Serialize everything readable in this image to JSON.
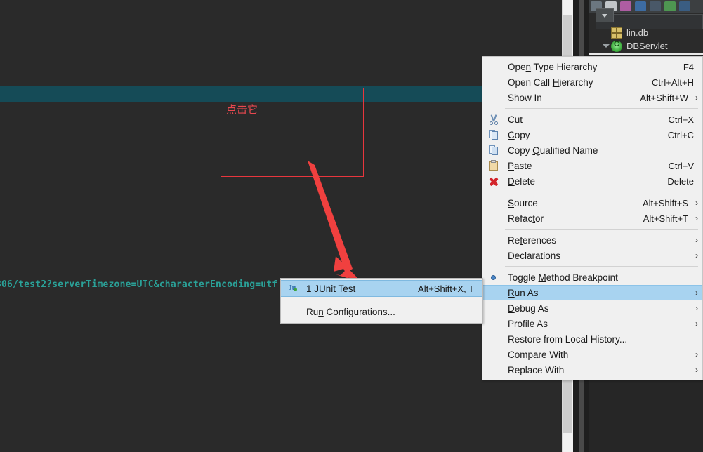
{
  "editor": {
    "code_line": "306/test2?serverTimezone=UTC&characterEncoding=utf",
    "code_color": "#2aa198",
    "background": "#2a2a2a",
    "selected_line_color": "#154b57"
  },
  "annotation": {
    "text": "点击它",
    "color": "#e8484f",
    "box_border_color": "#e8363d",
    "arrow_color": "#f0403f"
  },
  "package_explorer": {
    "tree": [
      {
        "label": "lin.db",
        "icon": "database-icon",
        "expandable": false
      },
      {
        "label": "DBServlet",
        "icon": "java-class-icon",
        "expandable": true
      }
    ]
  },
  "context_menu": {
    "items": [
      {
        "label": "Open Type Hierarchy",
        "accel": "F4",
        "icon": "",
        "submenu": false,
        "selected": false,
        "mnemonic": 3
      },
      {
        "label": "Open Call Hierarchy",
        "accel": "Ctrl+Alt+H",
        "icon": "",
        "submenu": false,
        "selected": false,
        "mnemonic": 10
      },
      {
        "label": "Show In",
        "accel": "Alt+Shift+W",
        "icon": "",
        "submenu": true,
        "selected": false,
        "mnemonic": 3
      },
      {
        "separator": true
      },
      {
        "label": "Cut",
        "accel": "Ctrl+X",
        "icon": "cut-icon",
        "submenu": false,
        "selected": false,
        "mnemonic": 2
      },
      {
        "label": "Copy",
        "accel": "Ctrl+C",
        "icon": "copy-icon",
        "submenu": false,
        "selected": false,
        "mnemonic": 0
      },
      {
        "label": "Copy Qualified Name",
        "accel": "",
        "icon": "copy-qualified-icon",
        "submenu": false,
        "selected": false,
        "mnemonic": 6
      },
      {
        "label": "Paste",
        "accel": "Ctrl+V",
        "icon": "paste-icon",
        "submenu": false,
        "selected": false,
        "mnemonic": 0
      },
      {
        "label": "Delete",
        "accel": "Delete",
        "icon": "delete-icon",
        "submenu": false,
        "selected": false,
        "mnemonic": 0
      },
      {
        "separator": true
      },
      {
        "label": "Source",
        "accel": "Alt+Shift+S",
        "icon": "",
        "submenu": true,
        "selected": false,
        "mnemonic": 0
      },
      {
        "label": "Refactor",
        "accel": "Alt+Shift+T",
        "icon": "",
        "submenu": true,
        "selected": false,
        "mnemonic": 6
      },
      {
        "separator": true
      },
      {
        "label": "References",
        "accel": "",
        "icon": "",
        "submenu": true,
        "selected": false,
        "mnemonic": 2
      },
      {
        "label": "Declarations",
        "accel": "",
        "icon": "",
        "submenu": true,
        "selected": false,
        "mnemonic": 2
      },
      {
        "separator": true
      },
      {
        "label": "Toggle Method Breakpoint",
        "accel": "",
        "icon": "breakpoint-icon",
        "submenu": false,
        "selected": false,
        "mnemonic": 7
      },
      {
        "label": "Run As",
        "accel": "",
        "icon": "",
        "submenu": true,
        "selected": true,
        "mnemonic": 0
      },
      {
        "label": "Debug As",
        "accel": "",
        "icon": "",
        "submenu": true,
        "selected": false,
        "mnemonic": 0
      },
      {
        "label": "Profile As",
        "accel": "",
        "icon": "",
        "submenu": true,
        "selected": false,
        "mnemonic": 0
      },
      {
        "label": "Restore from Local History...",
        "accel": "",
        "icon": "",
        "submenu": false,
        "selected": false,
        "mnemonic": 20
      },
      {
        "label": "Compare With",
        "accel": "",
        "icon": "",
        "submenu": true,
        "selected": false,
        "mnemonic": -1
      },
      {
        "label": "Replace With",
        "accel": "",
        "icon": "",
        "submenu": true,
        "selected": false,
        "mnemonic": -1
      }
    ],
    "highlight_color": "#a8d3f0",
    "background": "#f0f0f0"
  },
  "run_as_submenu": {
    "items": [
      {
        "label": "1 JUnit Test",
        "accel": "Alt+Shift+X, T",
        "icon": "junit-icon",
        "selected": true,
        "mnemonic": 0
      },
      {
        "separator": true
      },
      {
        "label": "Run Configurations...",
        "accel": "",
        "icon": "",
        "selected": false,
        "mnemonic": 2
      }
    ]
  }
}
